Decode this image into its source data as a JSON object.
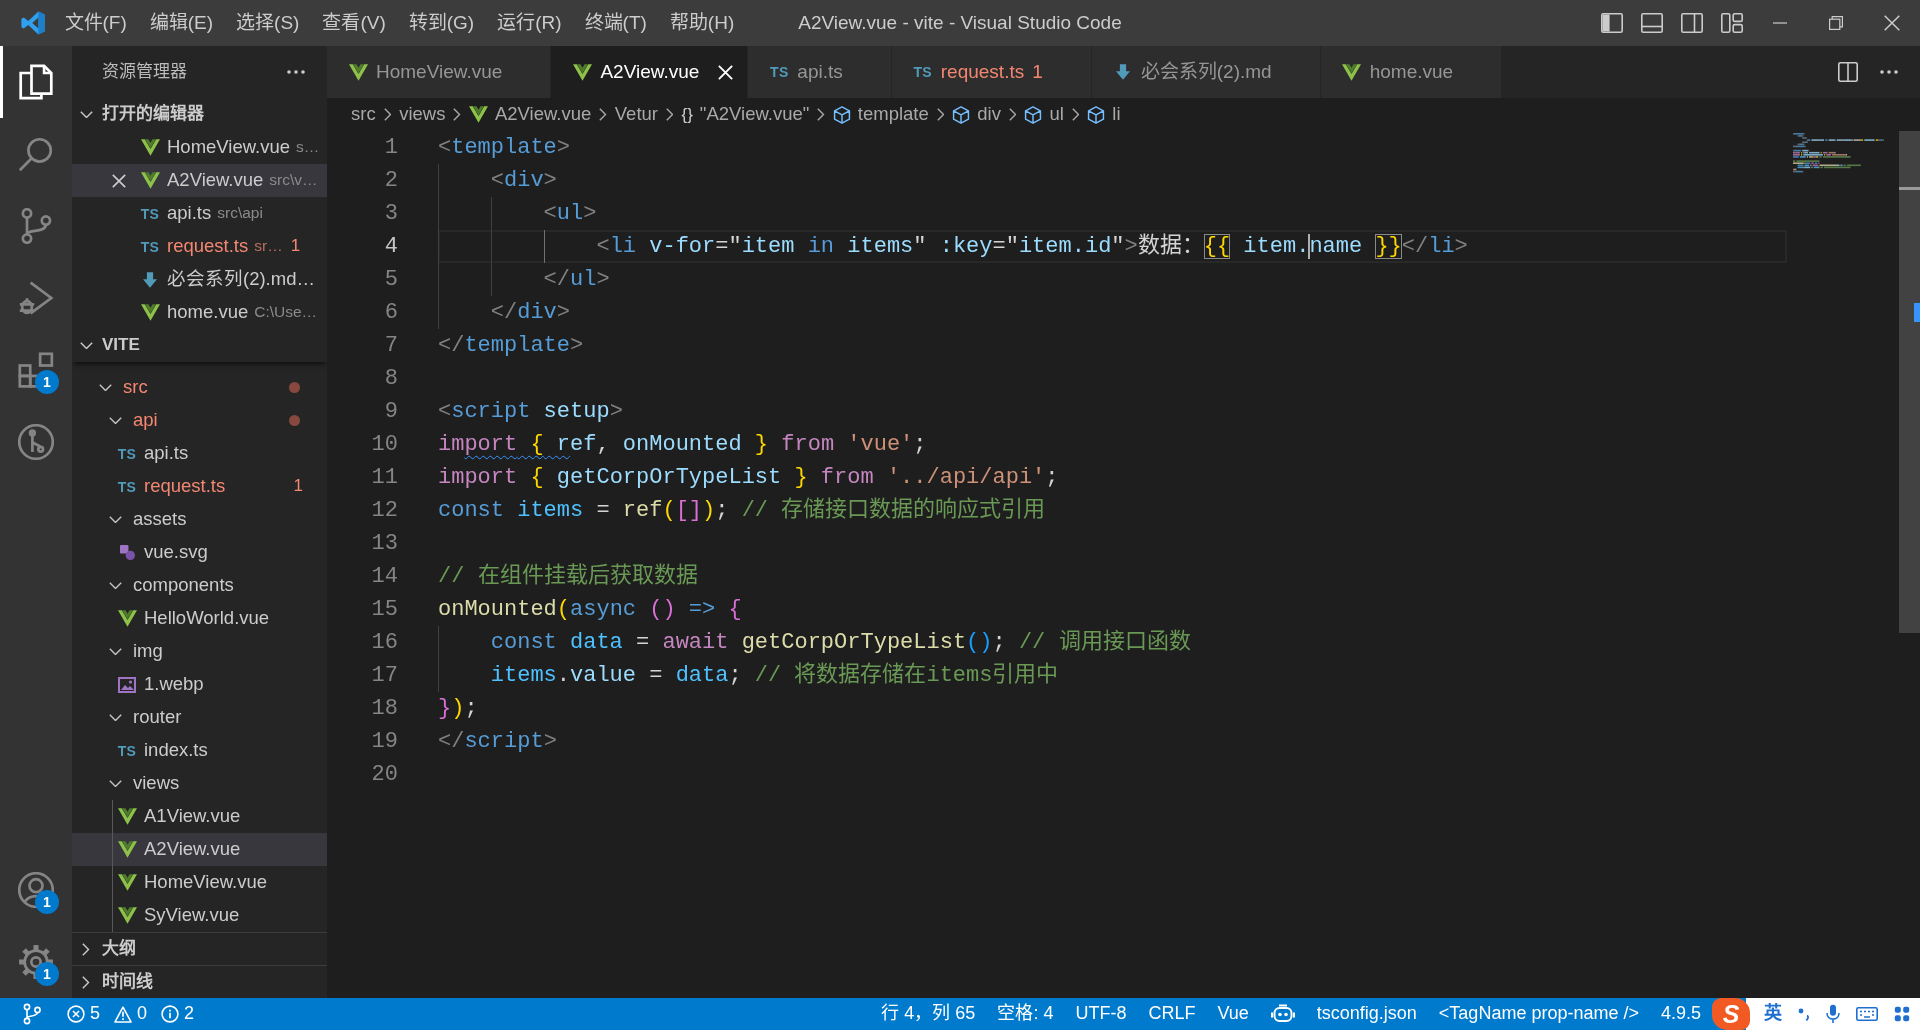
{
  "title_bar": {
    "menu": [
      "文件(F)",
      "编辑(E)",
      "选择(S)",
      "查看(V)",
      "转到(G)",
      "运行(R)",
      "终端(T)",
      "帮助(H)"
    ],
    "title": "A2View.vue - vite - Visual Studio Code",
    "layout_toggles": [
      {
        "kind": "primary-sidebar",
        "on": true
      },
      {
        "kind": "panel",
        "on": false
      },
      {
        "kind": "secondary-sidebar",
        "on": false
      }
    ]
  },
  "activity_bar": {
    "items": [
      {
        "kind": "explorer",
        "selected": true
      },
      {
        "kind": "search",
        "selected": false
      },
      {
        "kind": "source-control",
        "selected": false
      },
      {
        "kind": "run-debug",
        "selected": false
      },
      {
        "kind": "extensions",
        "selected": false,
        "badge": "1"
      },
      {
        "kind": "git-graph",
        "selected": false
      }
    ],
    "bottom": [
      {
        "kind": "accounts",
        "badge": "1"
      },
      {
        "kind": "manage",
        "badge": "1"
      }
    ]
  },
  "sidebar": {
    "title": "资源管理器",
    "open_editors": {
      "title": "打开的编辑器",
      "expanded": true,
      "items": [
        {
          "name": "HomeView.vue",
          "kind": "vue",
          "description": "s…",
          "selected": false,
          "error": false
        },
        {
          "name": "A2View.vue",
          "kind": "vue",
          "description": "src\\v…",
          "selected": true,
          "error": false
        },
        {
          "name": "api.ts",
          "kind": "ts",
          "icon_label": "TS",
          "description": "src\\api",
          "selected": false,
          "error": false
        },
        {
          "name": "request.ts",
          "kind": "ts",
          "icon_label": "TS",
          "description": "sr…",
          "problems": "1",
          "selected": false,
          "error": true
        },
        {
          "name": "必会系列(2).md…",
          "kind": "md",
          "selected": false,
          "error": false
        },
        {
          "name": "home.vue",
          "kind": "vue",
          "description": "C:\\Use…",
          "selected": false,
          "error": false
        }
      ]
    },
    "explorer": {
      "title": "VITE",
      "expanded": true,
      "tree": [
        {
          "name": "src",
          "kind": "folder",
          "expanded": true,
          "error": true,
          "selected": false,
          "children": [
            {
              "name": "api",
              "kind": "folder",
              "expanded": true,
              "error": true,
              "selected": false,
              "children": [
                {
                  "name": "api.ts",
                  "kind": "ts",
                  "icon_label": "TS",
                  "error": false,
                  "selected": false
                },
                {
                  "name": "request.ts",
                  "kind": "ts",
                  "icon_label": "TS",
                  "error": true,
                  "problems": "1",
                  "selected": false
                }
              ]
            },
            {
              "name": "assets",
              "kind": "folder",
              "expanded": true,
              "error": false,
              "selected": false,
              "children": [
                {
                  "name": "vue.svg",
                  "kind": "svg",
                  "error": false,
                  "selected": false
                }
              ]
            },
            {
              "name": "components",
              "kind": "folder",
              "expanded": true,
              "error": false,
              "selected": false,
              "children": [
                {
                  "name": "HelloWorld.vue",
                  "kind": "vue",
                  "error": false,
                  "selected": false
                }
              ]
            },
            {
              "name": "img",
              "kind": "folder",
              "expanded": true,
              "error": false,
              "selected": false,
              "children": [
                {
                  "name": "1.webp",
                  "kind": "image",
                  "error": false,
                  "selected": false
                }
              ]
            },
            {
              "name": "router",
              "kind": "folder",
              "expanded": true,
              "error": false,
              "selected": false,
              "children": [
                {
                  "name": "index.ts",
                  "kind": "ts",
                  "icon_label": "TS",
                  "error": false,
                  "selected": false
                }
              ]
            },
            {
              "name": "views",
              "kind": "folder",
              "expanded": true,
              "error": false,
              "selected": false,
              "children": [
                {
                  "name": "A1View.vue",
                  "kind": "vue",
                  "error": false,
                  "selected": false
                },
                {
                  "name": "A2View.vue",
                  "kind": "vue",
                  "error": false,
                  "selected": true
                },
                {
                  "name": "HomeView.vue",
                  "kind": "vue",
                  "error": false,
                  "selected": false
                },
                {
                  "name": "SyView.vue",
                  "kind": "vue",
                  "error": false,
                  "selected": false
                }
              ]
            }
          ]
        }
      ]
    },
    "panels": [
      {
        "title": "大纲",
        "expanded": false
      },
      {
        "title": "时间线",
        "expanded": false
      }
    ]
  },
  "editor": {
    "tabs": [
      {
        "label": "HomeView.vue",
        "kind": "vue",
        "selected": false,
        "error": false
      },
      {
        "label": "A2View.vue",
        "kind": "vue",
        "selected": true,
        "error": false
      },
      {
        "label": "api.ts",
        "kind": "ts",
        "icon_label": "TS",
        "selected": false,
        "error": false
      },
      {
        "label": "request.ts",
        "kind": "ts",
        "icon_label": "TS",
        "selected": false,
        "error": true,
        "problems": "1"
      },
      {
        "label": "必会系列(2).md",
        "kind": "md",
        "selected": false,
        "error": false
      },
      {
        "label": "home.vue",
        "kind": "vue",
        "selected": false,
        "error": false
      }
    ],
    "breadcrumbs": [
      {
        "label": "src",
        "kind": "plain"
      },
      {
        "label": "views",
        "kind": "plain"
      },
      {
        "label": "A2View.vue",
        "kind": "vue"
      },
      {
        "label": "Vetur",
        "kind": "plain"
      },
      {
        "label": "\"A2View.vue\"",
        "kind": "module",
        "icon_label": "{}"
      },
      {
        "label": "template",
        "kind": "element"
      },
      {
        "label": "div",
        "kind": "element"
      },
      {
        "label": "ul",
        "kind": "element"
      },
      {
        "label": "li",
        "kind": "element"
      }
    ],
    "lines": [
      {
        "number": "1",
        "current": false,
        "tokens": [
          {
            "kind": "punct",
            "text": "<"
          },
          {
            "kind": "tag",
            "text": "template"
          },
          {
            "kind": "punct",
            "text": ">"
          }
        ]
      },
      {
        "number": "2",
        "current": false,
        "tokens": [
          {
            "kind": "punct",
            "text": "    <"
          },
          {
            "kind": "tag",
            "text": "div"
          },
          {
            "kind": "punct",
            "text": ">"
          }
        ]
      },
      {
        "number": "3",
        "current": false,
        "tokens": [
          {
            "kind": "punct",
            "text": "        <"
          },
          {
            "kind": "tag",
            "text": "ul"
          },
          {
            "kind": "punct",
            "text": ">"
          }
        ]
      },
      {
        "number": "4",
        "current": true,
        "tokens": [
          {
            "kind": "punct",
            "text": "            <"
          },
          {
            "kind": "tag",
            "text": "li"
          },
          {
            "kind": "attr",
            "text": " v-for"
          },
          {
            "kind": "text",
            "text": "=\""
          },
          {
            "kind": "var",
            "text": "item"
          },
          {
            "kind": "keyword",
            "text": " in"
          },
          {
            "kind": "var",
            "text": " items"
          },
          {
            "kind": "text",
            "text": "\""
          },
          {
            "kind": "attr",
            "text": " :key"
          },
          {
            "kind": "text",
            "text": "=\""
          },
          {
            "kind": "var",
            "text": "item.id"
          },
          {
            "kind": "text",
            "text": "\""
          },
          {
            "kind": "punct",
            "text": ">"
          },
          {
            "kind": "text",
            "text": "数据："
          },
          {
            "kind": "bracket-match",
            "text": "{{"
          },
          {
            "kind": "var",
            "text": " item."
          },
          {
            "kind": "cursor"
          },
          {
            "kind": "var",
            "text": "name "
          },
          {
            "kind": "bracket-match",
            "text": "}}"
          },
          {
            "kind": "punct",
            "text": "</"
          },
          {
            "kind": "tag",
            "text": "li"
          },
          {
            "kind": "punct",
            "text": ">"
          }
        ]
      },
      {
        "number": "5",
        "current": false,
        "tokens": [
          {
            "kind": "punct",
            "text": "        </"
          },
          {
            "kind": "tag",
            "text": "ul"
          },
          {
            "kind": "punct",
            "text": ">"
          }
        ]
      },
      {
        "number": "6",
        "current": false,
        "tokens": [
          {
            "kind": "punct",
            "text": "    </"
          },
          {
            "kind": "tag",
            "text": "div"
          },
          {
            "kind": "punct",
            "text": ">"
          }
        ]
      },
      {
        "number": "7",
        "current": false,
        "tokens": [
          {
            "kind": "punct",
            "text": "</"
          },
          {
            "kind": "tag",
            "text": "template"
          },
          {
            "kind": "punct",
            "text": ">"
          }
        ]
      },
      {
        "number": "8",
        "current": false
      },
      {
        "number": "9",
        "current": false,
        "tokens": [
          {
            "kind": "punct",
            "text": "<"
          },
          {
            "kind": "tag",
            "text": "script"
          },
          {
            "kind": "attr",
            "text": " setup"
          },
          {
            "kind": "punct",
            "text": ">"
          }
        ]
      },
      {
        "number": "10",
        "current": false,
        "tokens": [
          {
            "kind": "control",
            "text": "im"
          },
          {
            "kind": "squiggle",
            "tokens": [
              {
                "kind": "control",
                "text": "port"
              },
              {
                "kind": "bracket1",
                "text": " {"
              },
              {
                "kind": "var",
                "text": " r"
              }
            ]
          },
          {
            "kind": "var",
            "text": "ef"
          },
          {
            "kind": "text",
            "text": ", "
          },
          {
            "kind": "var",
            "text": "onMounted"
          },
          {
            "kind": "bracket1",
            "text": " }"
          },
          {
            "kind": "control",
            "text": " from"
          },
          {
            "kind": "string",
            "text": " 'vue'"
          },
          {
            "kind": "text",
            "text": ";"
          }
        ]
      },
      {
        "number": "11",
        "current": false,
        "tokens": [
          {
            "kind": "control",
            "text": "import"
          },
          {
            "kind": "bracket1",
            "text": " {"
          },
          {
            "kind": "var",
            "text": " getCorpOrTypeList "
          },
          {
            "kind": "bracket1",
            "text": "}"
          },
          {
            "kind": "control",
            "text": " from"
          },
          {
            "kind": "string",
            "text": " '../api/api'"
          },
          {
            "kind": "text",
            "text": ";"
          }
        ]
      },
      {
        "number": "12",
        "current": false,
        "tokens": [
          {
            "kind": "keyword",
            "text": "const"
          },
          {
            "kind": "const",
            "text": " items"
          },
          {
            "kind": "text",
            "text": " = "
          },
          {
            "kind": "func",
            "text": "ref"
          },
          {
            "kind": "bracket1",
            "text": "("
          },
          {
            "kind": "bracket2",
            "text": "[]"
          },
          {
            "kind": "bracket1",
            "text": ")"
          },
          {
            "kind": "text",
            "text": "; "
          },
          {
            "kind": "comment",
            "text": "// 存储接口数据的响应式引用"
          }
        ]
      },
      {
        "number": "13",
        "current": false
      },
      {
        "number": "14",
        "current": false,
        "tokens": [
          {
            "kind": "comment",
            "text": "// 在组件挂载后获取数据"
          }
        ]
      },
      {
        "number": "15",
        "current": false,
        "tokens": [
          {
            "kind": "func",
            "text": "onMounted"
          },
          {
            "kind": "bracket1",
            "text": "("
          },
          {
            "kind": "keyword",
            "text": "async"
          },
          {
            "kind": "bracket2",
            "text": " ()"
          },
          {
            "kind": "keyword",
            "text": " =>"
          },
          {
            "kind": "bracket2",
            "text": " {"
          }
        ]
      },
      {
        "number": "16",
        "current": false,
        "tokens": [
          {
            "kind": "keyword",
            "text": "    const"
          },
          {
            "kind": "const",
            "text": " data"
          },
          {
            "kind": "text",
            "text": " = "
          },
          {
            "kind": "control",
            "text": "await"
          },
          {
            "kind": "func",
            "text": " getCorpOrTypeList"
          },
          {
            "kind": "bracket3",
            "text": "()"
          },
          {
            "kind": "text",
            "text": "; "
          },
          {
            "kind": "comment",
            "text": "// 调用接口函数"
          }
        ]
      },
      {
        "number": "17",
        "current": false,
        "tokens": [
          {
            "kind": "const",
            "text": "    items"
          },
          {
            "kind": "text",
            "text": "."
          },
          {
            "kind": "var",
            "text": "value"
          },
          {
            "kind": "text",
            "text": " = "
          },
          {
            "kind": "const",
            "text": "data"
          },
          {
            "kind": "text",
            "text": "; "
          },
          {
            "kind": "comment",
            "text": "// 将数据存储在items引用中"
          }
        ]
      },
      {
        "number": "18",
        "current": false,
        "tokens": [
          {
            "kind": "bracket2",
            "text": "}"
          },
          {
            "kind": "bracket1",
            "text": ")"
          },
          {
            "kind": "text",
            "text": ";"
          }
        ]
      },
      {
        "number": "19",
        "current": false,
        "tokens": [
          {
            "kind": "punct",
            "text": "</"
          },
          {
            "kind": "tag",
            "text": "script"
          },
          {
            "kind": "punct",
            "text": ">"
          }
        ]
      },
      {
        "number": "20",
        "current": false
      }
    ]
  },
  "status_bar": {
    "problems": {
      "errors": "5",
      "warnings": "0",
      "infos": "2"
    },
    "items": [
      {
        "kind": "text",
        "label": "行 4，列 65"
      },
      {
        "kind": "text",
        "label": "空格: 4"
      },
      {
        "kind": "text",
        "label": "UTF-8"
      },
      {
        "kind": "text",
        "label": "CRLF"
      },
      {
        "kind": "text",
        "label": "Vue"
      },
      {
        "kind": "assistant"
      },
      {
        "kind": "text",
        "label": "tsconfig.json"
      },
      {
        "kind": "text",
        "label": "<TagName prop-name />"
      },
      {
        "kind": "text",
        "label": "4.9.5"
      }
    ],
    "ime": {
      "logo": "S",
      "mode": "英"
    }
  }
}
